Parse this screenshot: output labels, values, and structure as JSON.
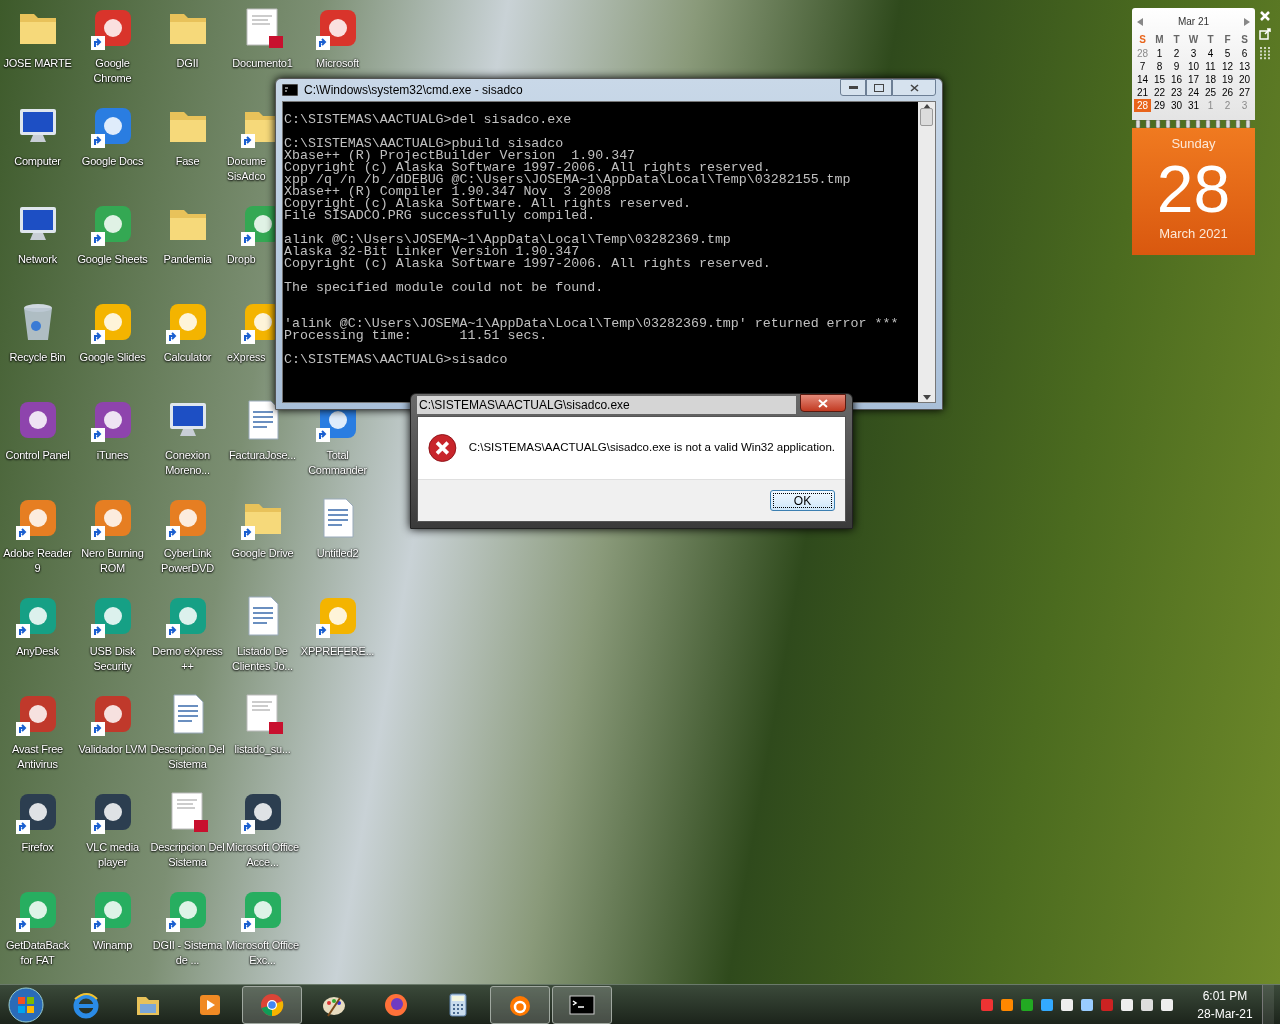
{
  "desktop_icons": [
    [
      {
        "label": "JOSE  MARTE",
        "kind": "folder",
        "shortcut": false
      },
      {
        "label": "Computer",
        "kind": "computer",
        "shortcut": false
      },
      {
        "label": "Network",
        "kind": "computer",
        "shortcut": false
      },
      {
        "label": "Recycle Bin",
        "kind": "bin",
        "shortcut": false
      },
      {
        "label": "Control Panel",
        "kind": "app",
        "shortcut": false
      },
      {
        "label": "Adobe Reader 9",
        "kind": "app",
        "shortcut": true
      },
      {
        "label": "AnyDesk",
        "kind": "app",
        "shortcut": true
      },
      {
        "label": "Avast Free Antivirus",
        "kind": "app",
        "shortcut": true
      },
      {
        "label": "Firefox",
        "kind": "app",
        "shortcut": true
      },
      {
        "label": "GetDataBack for FAT",
        "kind": "app",
        "shortcut": true
      }
    ],
    [
      {
        "label": "Google Chrome",
        "kind": "app",
        "shortcut": true
      },
      {
        "label": "Google Docs",
        "kind": "app",
        "shortcut": true
      },
      {
        "label": "Google Sheets",
        "kind": "app",
        "shortcut": true
      },
      {
        "label": "Google Slides",
        "kind": "app",
        "shortcut": true
      },
      {
        "label": "iTunes",
        "kind": "app",
        "shortcut": true
      },
      {
        "label": "Nero Burning ROM",
        "kind": "app",
        "shortcut": true
      },
      {
        "label": "USB Disk Security",
        "kind": "app",
        "shortcut": true
      },
      {
        "label": "Validador LVM",
        "kind": "app",
        "shortcut": true
      },
      {
        "label": "VLC media player",
        "kind": "app",
        "shortcut": true
      },
      {
        "label": "Winamp",
        "kind": "app",
        "shortcut": true
      }
    ],
    [
      {
        "label": "DGII",
        "kind": "folder",
        "shortcut": false
      },
      {
        "label": "Fase",
        "kind": "folder",
        "shortcut": false
      },
      {
        "label": "Pandemia",
        "kind": "folder",
        "shortcut": false
      },
      {
        "label": "Calculator",
        "kind": "app",
        "shortcut": true
      },
      {
        "label": "Conexion Moreno...",
        "kind": "computer",
        "shortcut": false
      },
      {
        "label": "CyberLink PowerDVD",
        "kind": "app",
        "shortcut": true
      },
      {
        "label": "Demo eXpress ++",
        "kind": "app",
        "shortcut": true
      },
      {
        "label": "Descripcion Del Sistema",
        "kind": "document",
        "shortcut": false
      },
      {
        "label": "Descripcion Del Sistema",
        "kind": "pdf",
        "shortcut": false
      },
      {
        "label": "DGII - Sistema de ...",
        "kind": "app",
        "shortcut": true
      }
    ],
    [
      {
        "label": "Documento1",
        "kind": "pdf",
        "shortcut": false
      },
      {
        "label": "Docume SisAdco",
        "kind": "folder",
        "shortcut": true,
        "partial": true
      },
      {
        "label": "Dropb",
        "kind": "app",
        "shortcut": true,
        "partial": true
      },
      {
        "label": "eXpress",
        "kind": "app",
        "shortcut": true,
        "partial": true
      },
      {
        "label": "FacturaJose...",
        "kind": "document",
        "shortcut": false
      },
      {
        "label": "Google Drive",
        "kind": "folder",
        "shortcut": true
      },
      {
        "label": "Listado De Clientes Jo...",
        "kind": "document",
        "shortcut": false
      },
      {
        "label": "listado_su...",
        "kind": "pdf",
        "shortcut": false
      },
      {
        "label": "Microsoft Office Acce...",
        "kind": "app",
        "shortcut": true
      },
      {
        "label": "Microsoft Office Exc...",
        "kind": "app",
        "shortcut": true
      }
    ],
    [
      {
        "label": "Microsoft",
        "kind": "app",
        "shortcut": true
      },
      {
        "label": "Total Commander",
        "kind": "app",
        "shortcut": true
      },
      {
        "label": "Untitled2",
        "kind": "document",
        "shortcut": false
      },
      {
        "label": "XPPREFERE...",
        "kind": "app",
        "shortcut": true
      }
    ]
  ],
  "console_window": {
    "title": "C:\\Windows\\system32\\cmd.exe - sisadco",
    "output": "C:\\SISTEMAS\\AACTUALG>del sisadco.exe\n\nC:\\SISTEMAS\\AACTUALG>pbuild sisadco\nXbase++ (R) ProjectBuilder Version  1.90.347\nCopyright (c) Alaska Software 1997-2006. All rights reserved.\nxpp /q /n /b /dDEBUG @C:\\Users\\JOSEMA~1\\AppData\\Local\\Temp\\03282155.tmp\nXbase++ (R) Compiler 1.90.347 Nov  3 2008\nCopyright (c) Alaska Software. All rights reserved.\nFile SISADCO.PRG successfully compiled.\n\nalink @C:\\Users\\JOSEMA~1\\AppData\\Local\\Temp\\03282369.tmp\nAlaska 32-Bit Linker Version 1.90.347\nCopyright (c) Alaska Software 1997-2006. All rights reserved.\n\nThe specified module could not be found.\n\n\n'alink @C:\\Users\\JOSEMA~1\\AppData\\Local\\Temp\\03282369.tmp' returned error ***\nProcessing time:      11.51 secs.\n\nC:\\SISTEMAS\\AACTUALG>sisadco"
  },
  "error_dialog": {
    "title": "C:\\SISTEMAS\\AACTUALG\\sisadco.exe",
    "message": "C:\\SISTEMAS\\AACTUALG\\sisadco.exe is not a valid Win32 application.",
    "button": "OK"
  },
  "calendar_gadget": {
    "month": "Mar 21",
    "weekdays": [
      "S",
      "M",
      "T",
      "W",
      "T",
      "F",
      "S"
    ],
    "weeks": [
      [
        {
          "day": "28",
          "in_month": false,
          "selected": false
        },
        {
          "day": "1",
          "in_month": true,
          "selected": false
        },
        {
          "day": "2",
          "in_month": true,
          "selected": false
        },
        {
          "day": "3",
          "in_month": true,
          "selected": false
        },
        {
          "day": "4",
          "in_month": true,
          "selected": false
        },
        {
          "day": "5",
          "in_month": true,
          "selected": false
        },
        {
          "day": "6",
          "in_month": true,
          "selected": false
        }
      ],
      [
        {
          "day": "7",
          "in_month": true,
          "selected": false
        },
        {
          "day": "8",
          "in_month": true,
          "selected": false
        },
        {
          "day": "9",
          "in_month": true,
          "selected": false
        },
        {
          "day": "10",
          "in_month": true,
          "selected": false
        },
        {
          "day": "11",
          "in_month": true,
          "selected": false
        },
        {
          "day": "12",
          "in_month": true,
          "selected": false
        },
        {
          "day": "13",
          "in_month": true,
          "selected": false
        }
      ],
      [
        {
          "day": "14",
          "in_month": true,
          "selected": false
        },
        {
          "day": "15",
          "in_month": true,
          "selected": false
        },
        {
          "day": "16",
          "in_month": true,
          "selected": false
        },
        {
          "day": "17",
          "in_month": true,
          "selected": false
        },
        {
          "day": "18",
          "in_month": true,
          "selected": false
        },
        {
          "day": "19",
          "in_month": true,
          "selected": false
        },
        {
          "day": "20",
          "in_month": true,
          "selected": false
        }
      ],
      [
        {
          "day": "21",
          "in_month": true,
          "selected": false
        },
        {
          "day": "22",
          "in_month": true,
          "selected": false
        },
        {
          "day": "23",
          "in_month": true,
          "selected": false
        },
        {
          "day": "24",
          "in_month": true,
          "selected": false
        },
        {
          "day": "25",
          "in_month": true,
          "selected": false
        },
        {
          "day": "26",
          "in_month": true,
          "selected": false
        },
        {
          "day": "27",
          "in_month": true,
          "selected": false
        }
      ],
      [
        {
          "day": "28",
          "in_month": true,
          "selected": true
        },
        {
          "day": "29",
          "in_month": true,
          "selected": false
        },
        {
          "day": "30",
          "in_month": true,
          "selected": false
        },
        {
          "day": "31",
          "in_month": true,
          "selected": false
        },
        {
          "day": "1",
          "in_month": false,
          "selected": false
        },
        {
          "day": "2",
          "in_month": false,
          "selected": false
        },
        {
          "day": "3",
          "in_month": false,
          "selected": false
        }
      ]
    ],
    "weekday": "Sunday",
    "day": "28",
    "month_year": "March 2021"
  },
  "taskbar": {
    "buttons": [
      {
        "running": false
      },
      {
        "running": false
      },
      {
        "running": false
      },
      {
        "running": true
      },
      {
        "running": false
      },
      {
        "running": false
      },
      {
        "running": false
      },
      {
        "running": true
      },
      {
        "running": true
      }
    ],
    "time": "6:01 PM",
    "date": "28-Mar-21"
  }
}
